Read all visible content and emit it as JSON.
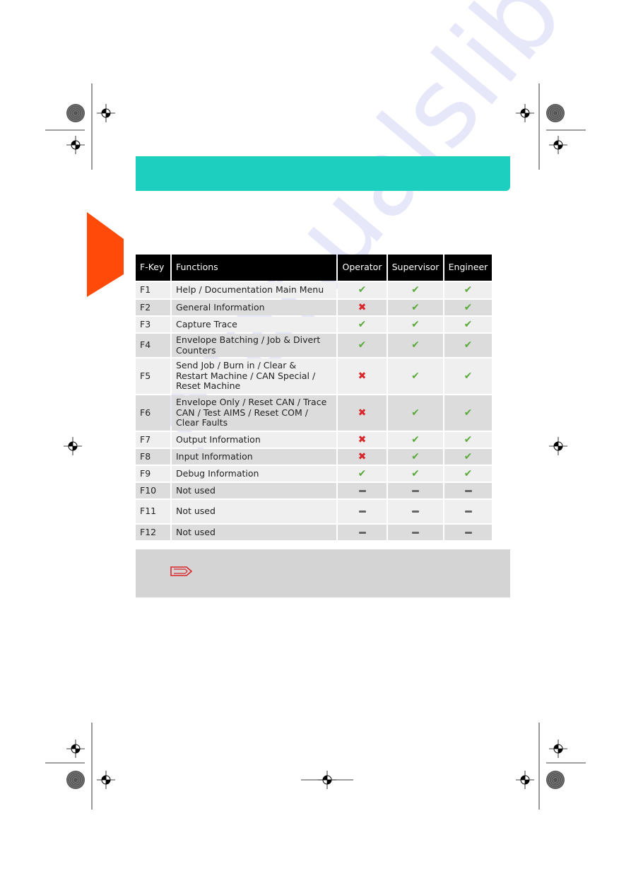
{
  "table": {
    "headers": [
      "F-Key",
      "Functions",
      "Operator",
      "Supervisor",
      "Engineer"
    ],
    "rows": [
      {
        "key": "F1",
        "function": "Help / Documentation Main Menu",
        "operator": "check",
        "supervisor": "check",
        "engineer": "check"
      },
      {
        "key": "F2",
        "function": "General Information",
        "operator": "cross",
        "supervisor": "check",
        "engineer": "check"
      },
      {
        "key": "F3",
        "function": "Capture Trace",
        "operator": "check",
        "supervisor": "check",
        "engineer": "check"
      },
      {
        "key": "F4",
        "function": "Envelope Batching / Job & Divert Counters",
        "operator": "check",
        "supervisor": "check",
        "engineer": "check"
      },
      {
        "key": "F5",
        "function": "Send Job / Burn in / Clear & Restart Machine / CAN Special / Reset Machine",
        "operator": "cross",
        "supervisor": "check",
        "engineer": "check"
      },
      {
        "key": "F6",
        "function": "Envelope Only / Reset CAN / Trace CAN / Test AIMS / Reset COM / Clear Faults",
        "operator": "cross",
        "supervisor": "check",
        "engineer": "check"
      },
      {
        "key": "F7",
        "function": "Output Information",
        "operator": "cross",
        "supervisor": "check",
        "engineer": "check"
      },
      {
        "key": "F8",
        "function": "Input Information",
        "operator": "cross",
        "supervisor": "check",
        "engineer": "check"
      },
      {
        "key": "F9",
        "function": "Debug Information",
        "operator": "check",
        "supervisor": "check",
        "engineer": "check"
      },
      {
        "key": "F10",
        "function": "Not used",
        "operator": "dash",
        "supervisor": "dash",
        "engineer": "dash"
      },
      {
        "key": "F11",
        "function": "Not used",
        "operator": "dash",
        "supervisor": "dash",
        "engineer": "dash"
      },
      {
        "key": "F12",
        "function": "Not used",
        "operator": "dash",
        "supervisor": "dash",
        "engineer": "dash"
      }
    ]
  },
  "colors": {
    "header_bar": "#1dcfbf",
    "side_tab": "#ff4a0a",
    "check": "#5aaa3c",
    "cross": "#d9262b",
    "note_bg": "#d4d4d4"
  },
  "icons": {
    "note": "paperclip-note-icon",
    "check": "check-icon",
    "cross": "cross-icon",
    "dash": "dash-icon"
  },
  "watermark": "manualslib.com"
}
